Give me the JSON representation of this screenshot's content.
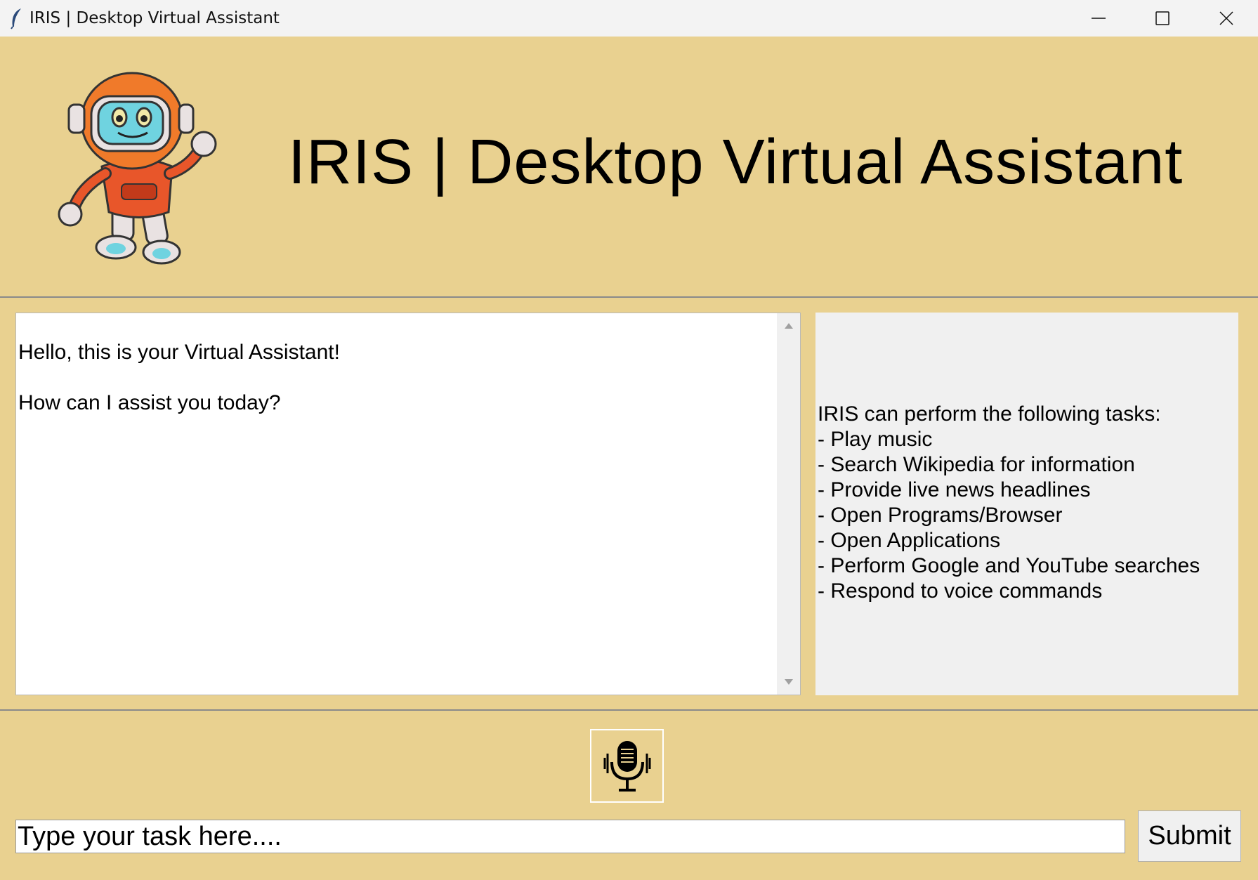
{
  "window": {
    "title": "IRIS | Desktop Virtual Assistant",
    "icon": "feather-icon",
    "controls": [
      "minimize-icon",
      "maximize-icon",
      "close-icon"
    ]
  },
  "header": {
    "title": "IRIS | Desktop Virtual Assistant",
    "logo": "robot-mascot"
  },
  "chat": {
    "lines": [
      "Hello, this is your Virtual Assistant!",
      "How can I assist you today?"
    ]
  },
  "tasks": {
    "heading": "IRIS can perform the following tasks:",
    "items": [
      "- Play music",
      "- Search Wikipedia for information",
      "- Provide live news headlines",
      "- Open Programs/Browser",
      "- Open Applications",
      "- Perform Google and YouTube searches",
      "- Respond to voice commands"
    ]
  },
  "input": {
    "placeholder": "Type your task here....",
    "value": ""
  },
  "buttons": {
    "submit": "Submit",
    "mic": "microphone-icon"
  },
  "colors": {
    "background": "#e9d190",
    "panel": "#f0f0f0",
    "chat_bg": "#ffffff"
  }
}
